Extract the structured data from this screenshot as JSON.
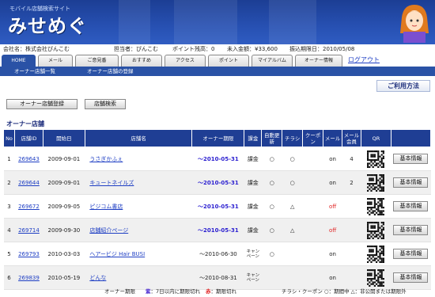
{
  "brand": {
    "subtitle": "モバイル店舗検索サイト",
    "logo": "みせめぐ"
  },
  "info": {
    "company": "会社名：株式会社ぴんこむ",
    "manager": "担当者：ぴんこむ",
    "points": "ポイント残高：0",
    "unpaid": "未入金額：¥33,600",
    "due": "振込期限日：2010/05/08"
  },
  "tabs": [
    "HOME",
    "メール",
    "ご意見番",
    "おすすめ",
    "アクセス",
    "ポイント",
    "マイアルバム",
    "オーナー情報"
  ],
  "logout": "ログアウト",
  "subnav": [
    "オーナー店舗一覧",
    "オーナー店舗の登録"
  ],
  "help_button": "ご利用方法",
  "buttons": {
    "register": "オーナー店舗登録",
    "search": "店舗検索"
  },
  "section_title": "オーナー店舗",
  "table": {
    "headers": [
      "No",
      "店舗ID",
      "開始日",
      "店舗名",
      "オーナー期限",
      "課金",
      "自動更新",
      "チラシ",
      "クーポン",
      "メール",
      "メール会員",
      "QR",
      ""
    ],
    "rows": [
      {
        "no": "1",
        "id": "269643",
        "start": "2009-09-01",
        "name": "うさぎかふぇ",
        "limit": "〜2010-05-31",
        "billing": "課金",
        "auto": "○",
        "flyer": "○",
        "coupon": "",
        "mail": "on",
        "members": "4",
        "action": "基本情報"
      },
      {
        "no": "2",
        "id": "269644",
        "start": "2009-09-01",
        "name": "キュートネイルズ",
        "limit": "〜2010-05-31",
        "billing": "課金",
        "auto": "○",
        "flyer": "○",
        "coupon": "",
        "mail": "on",
        "members": "2",
        "action": "基本情報"
      },
      {
        "no": "3",
        "id": "269672",
        "start": "2009-09-05",
        "name": "ピジコム書店",
        "limit": "〜2010-05-31",
        "billing": "課金",
        "auto": "○",
        "flyer": "△",
        "coupon": "",
        "mail": "off",
        "members": "",
        "action": "基本情報"
      },
      {
        "no": "4",
        "id": "269714",
        "start": "2009-09-30",
        "name": "店舗紹介ページ",
        "limit": "〜2010-05-31",
        "billing": "課金",
        "auto": "○",
        "flyer": "△",
        "coupon": "",
        "mail": "off",
        "members": "",
        "action": "基本情報"
      },
      {
        "no": "5",
        "id": "269793",
        "start": "2010-03-03",
        "name": "ヘアービジ Hair BUSI",
        "limit": "〜2010-06-30",
        "billing": "キャンペーン",
        "auto": "○",
        "flyer": "",
        "coupon": "",
        "mail": "on",
        "members": "",
        "action": "基本情報"
      },
      {
        "no": "6",
        "id": "269839",
        "start": "2010-05-19",
        "name": "どんな",
        "limit": "〜2010-08-31",
        "billing": "キャンペーン",
        "auto": "",
        "flyer": "",
        "coupon": "",
        "mail": "on",
        "members": "",
        "action": "基本情報"
      }
    ]
  },
  "footer": {
    "limit_label": "オーナー期限",
    "purple_mark": "紫",
    "purple_text": "：7日以内に期限切れ",
    "red_mark": "赤",
    "red_text": "：期限切れ",
    "legend": "チラシ・クーポン ○：期間中 △：非公開または期限外"
  },
  "colors": {
    "header": "#264fb0",
    "table_header": "#1f3e94",
    "link": "#1f3fc4",
    "off": "#e02020"
  }
}
